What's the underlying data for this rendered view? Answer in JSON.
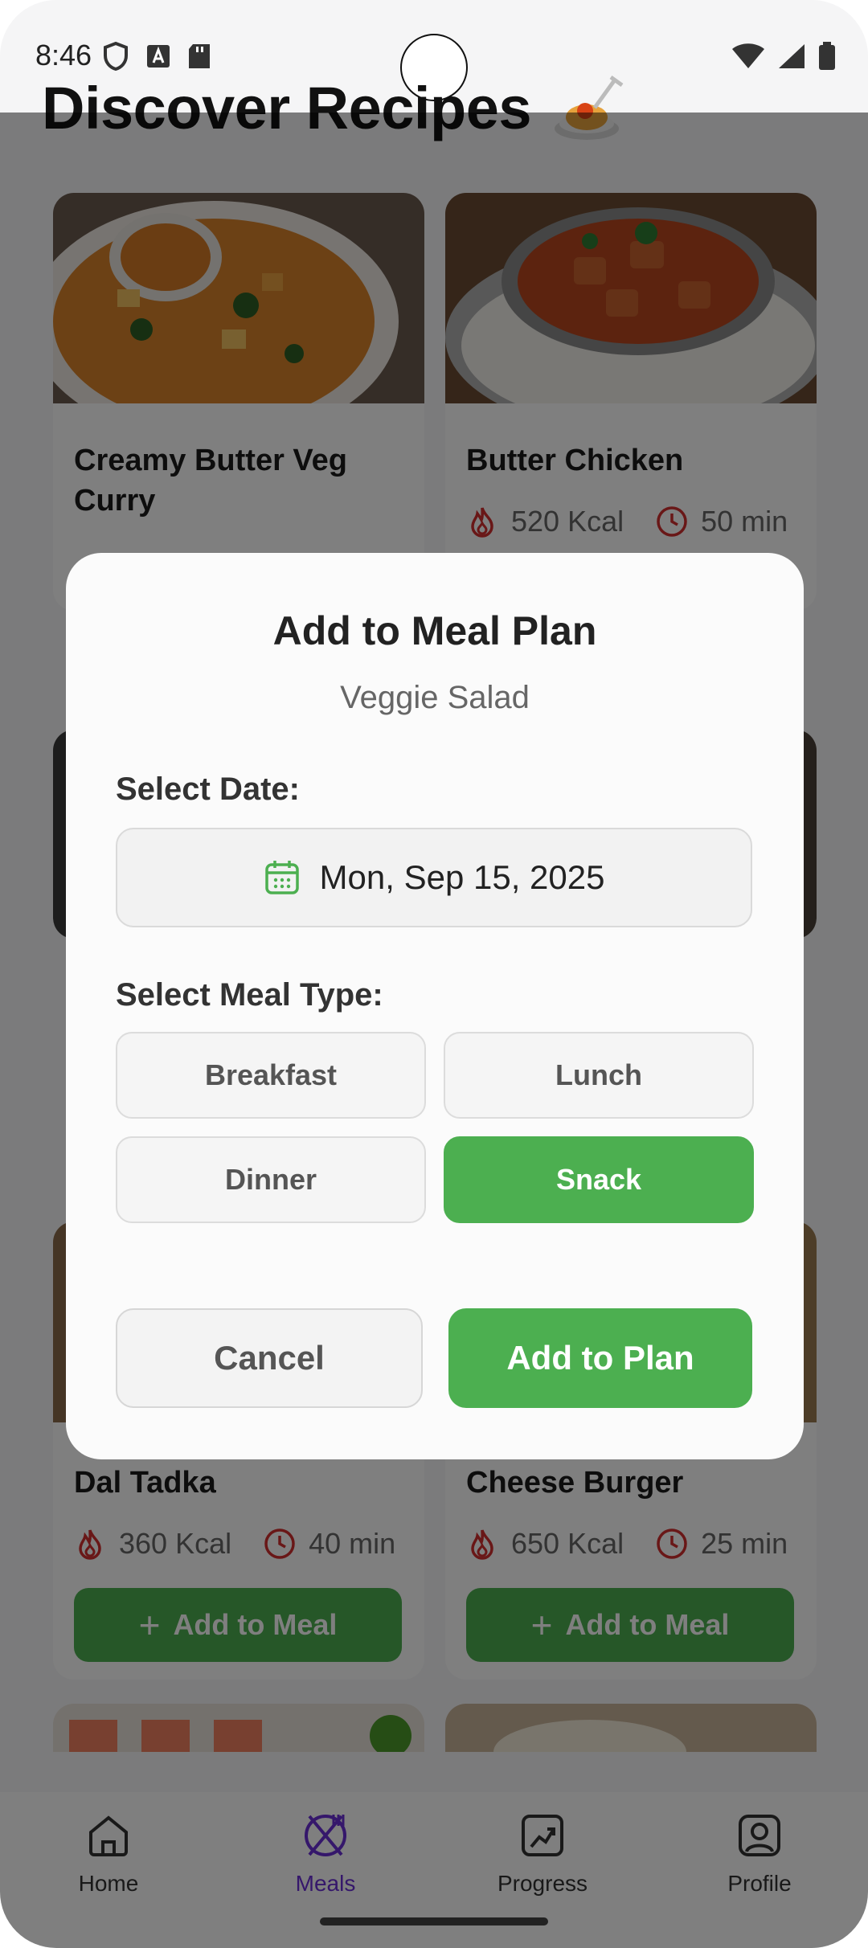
{
  "status_bar": {
    "time": "8:46"
  },
  "page": {
    "title": "Discover Recipes"
  },
  "recipes": [
    {
      "name": "Creamy Butter Veg Curry"
    },
    {
      "name": "Butter Chicken",
      "kcal": "520 Kcal",
      "time": "50 min"
    },
    {
      "name": "Dal Tadka",
      "kcal": "360 Kcal",
      "time": "40 min",
      "button": "Add to Meal"
    },
    {
      "name": "Cheese Burger",
      "kcal": "650 Kcal",
      "time": "25 min",
      "button": "Add to Meal"
    }
  ],
  "dialog": {
    "title": "Add to Meal Plan",
    "recipe": "Veggie Salad",
    "date_label": "Select Date:",
    "date_value": "Mon, Sep 15, 2025",
    "meal_type_label": "Select Meal Type:",
    "meal_types": [
      "Breakfast",
      "Lunch",
      "Dinner",
      "Snack"
    ],
    "selected_meal_type": "Snack",
    "cancel": "Cancel",
    "confirm": "Add to Plan"
  },
  "nav": {
    "items": [
      "Home",
      "Meals",
      "Progress",
      "Profile"
    ],
    "active": "Meals"
  },
  "colors": {
    "accent_green": "#4caf50",
    "active_nav": "#6a2fd6",
    "flame": "#d32f2f"
  }
}
